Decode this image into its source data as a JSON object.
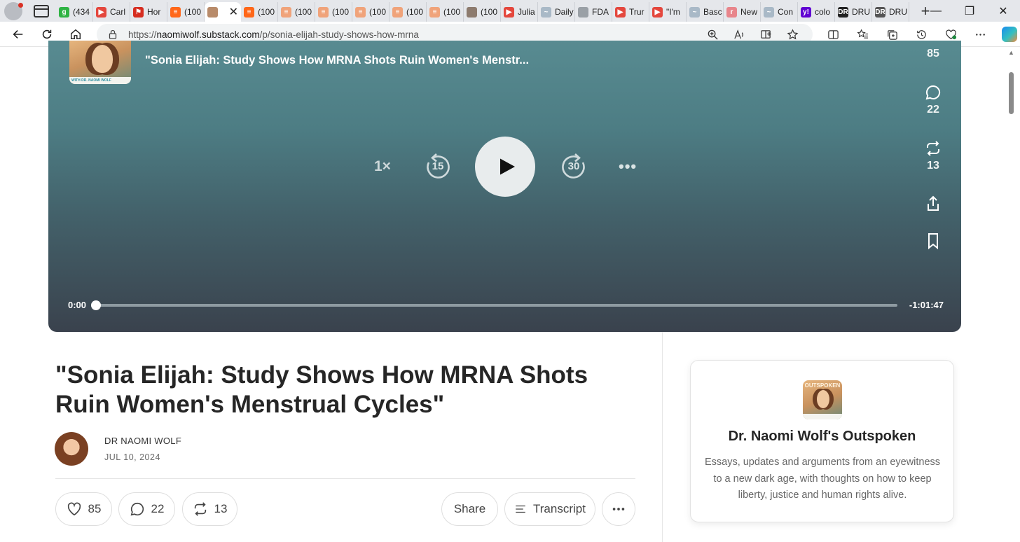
{
  "browser": {
    "tabs": [
      {
        "label": "(434",
        "icon": "g-app-icon",
        "color": "#2fb344",
        "glyph": "g"
      },
      {
        "label": "Carl",
        "icon": "youtube-icon",
        "color": "#e4473d",
        "glyph": "▶"
      },
      {
        "label": "Hor",
        "icon": "bookmark-red-icon",
        "color": "#d62d20",
        "glyph": "⚑"
      },
      {
        "label": "(100",
        "icon": "substack-icon",
        "color": "#ff6719",
        "glyph": "≡"
      },
      {
        "label": "",
        "icon": "photo-icon",
        "color": "#b88b6a",
        "glyph": "",
        "active": true
      },
      {
        "label": "(100",
        "icon": "substack-icon",
        "color": "#ff6719",
        "glyph": "≡"
      },
      {
        "label": "(100",
        "icon": "substack-icon",
        "color": "#f0a37a",
        "glyph": "≡"
      },
      {
        "label": "(100",
        "icon": "substack-icon",
        "color": "#f0a37a",
        "glyph": "≡"
      },
      {
        "label": "(100",
        "icon": "substack-icon",
        "color": "#f0a37a",
        "glyph": "≡"
      },
      {
        "label": "(100",
        "icon": "substack-icon",
        "color": "#f0a37a",
        "glyph": "≡"
      },
      {
        "label": "(100",
        "icon": "substack-icon",
        "color": "#f0a37a",
        "glyph": "≡"
      },
      {
        "label": "(100",
        "icon": "photo-icon",
        "color": "#8d7b6e",
        "glyph": ""
      },
      {
        "label": "Julia",
        "icon": "youtube-icon",
        "color": "#e4473d",
        "glyph": "▶"
      },
      {
        "label": "Daily",
        "icon": "pulse-icon",
        "color": "#a9b9c7",
        "glyph": "~"
      },
      {
        "label": "FDA",
        "icon": "document-icon",
        "color": "#9aa0a6",
        "glyph": ""
      },
      {
        "label": "Trur",
        "icon": "youtube-icon",
        "color": "#e4473d",
        "glyph": "▶"
      },
      {
        "label": "\"I'm",
        "icon": "youtube-icon",
        "color": "#e4473d",
        "glyph": "▶"
      },
      {
        "label": "Basc",
        "icon": "pulse-icon",
        "color": "#a9b9c7",
        "glyph": "~"
      },
      {
        "label": "New",
        "icon": "r-app-icon",
        "color": "#e8858b",
        "glyph": "r"
      },
      {
        "label": "Con",
        "icon": "pulse-icon",
        "color": "#a9b9c7",
        "glyph": "~"
      },
      {
        "label": "colo",
        "icon": "yahoo-icon",
        "color": "#6001d2",
        "glyph": "y!"
      },
      {
        "label": "DRU",
        "icon": "drudge-icon",
        "color": "#222222",
        "glyph": "DR"
      },
      {
        "label": "DRU",
        "icon": "drudge-icon",
        "color": "#555555",
        "glyph": "DR"
      }
    ],
    "url_prefix": "https://",
    "url_host": "naomiwolf.substack.com",
    "url_path": "/p/sonia-elijah-study-shows-how-mrna"
  },
  "player": {
    "title": "\"Sonia Elijah: Study Shows How MRNA Shots Ruin Women's Menstr...",
    "cover_band": "WITH DR. NAOMI WOLF",
    "speed": "1×",
    "skip_back": "15",
    "skip_fwd": "30",
    "like_count": "85",
    "comment_count": "22",
    "restack_count": "13",
    "time_elapsed": "0:00",
    "time_remaining": "-1:01:47",
    "progress": 0
  },
  "article": {
    "title": "\"Sonia Elijah: Study Shows How MRNA Shots Ruin Women's Menstrual Cycles\"",
    "author": "DR NAOMI WOLF",
    "date": "JUL 10, 2024",
    "likes": "85",
    "comments": "22",
    "restacks": "13",
    "share_label": "Share",
    "transcript_label": "Transcript"
  },
  "publication": {
    "logo_word": "OUTSPOKEN",
    "name": "Dr. Naomi Wolf's Outspoken",
    "description": "Essays, updates and arguments from an eyewitness to a new dark age, with thoughts on how to keep liberty, justice and human rights alive."
  }
}
